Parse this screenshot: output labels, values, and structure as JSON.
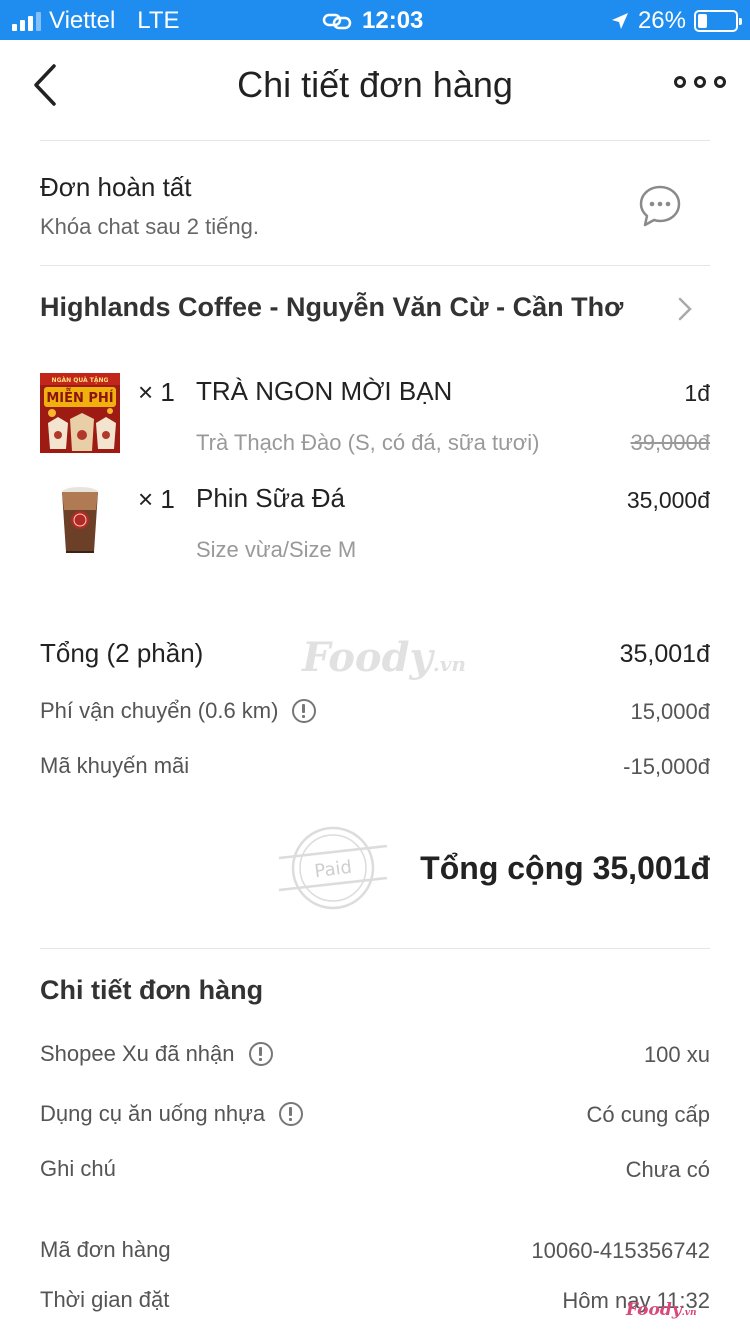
{
  "status_bar": {
    "carrier": "Viettel",
    "network": "LTE",
    "time": "12:03",
    "battery": "26%",
    "battery_level": 0.26
  },
  "header": {
    "title": "Chi tiết đơn hàng",
    "back_icon": "chevron-left-icon",
    "more_icon": "more-dots-icon"
  },
  "order_status": {
    "title": "Đơn hoàn tất",
    "subtitle": "Khóa chat sau 2 tiếng.",
    "chat_icon": "chat-bubble-icon"
  },
  "store": {
    "name": "Highlands Coffee - Nguyễn Văn Cừ - Cần Thơ"
  },
  "items": [
    {
      "qty": "× 1",
      "name": "TRÀ NGON MỜI BẠN",
      "price": "1đ",
      "note": "Trà Thạch Đào (S, có đá, sữa tươi)",
      "old_price": "39,000đ",
      "thumb_banner": "MIỄN PHÍ",
      "thumb_top": "NGÀN QUÀ TẶNG"
    },
    {
      "qty": "× 1",
      "name": "Phin Sữa Đá",
      "price": "35,000đ",
      "note": "Size vừa/Size M"
    }
  ],
  "summary": {
    "subtotal_label": "Tổng (2 phần)",
    "subtotal_value": "35,001đ",
    "shipping_label": "Phí vận chuyển (0.6 km)",
    "shipping_value": "15,000đ",
    "promo_label": "Mã khuyến mãi",
    "promo_value": "-15,000đ",
    "paid_stamp": "Paid",
    "grand_total": "Tổng cộng 35,001đ"
  },
  "watermark": {
    "brand": "Foody",
    "suffix": ".vn"
  },
  "details": {
    "section_title": "Chi tiết đơn hàng",
    "rows": [
      {
        "label": "Shopee Xu đã nhận",
        "value": "100 xu",
        "info": true
      },
      {
        "label": "Dụng cụ ăn uống nhựa",
        "value": "Có cung cấp",
        "info": true
      },
      {
        "label": "Ghi chú",
        "value": "Chưa có",
        "info": false
      },
      {
        "label": "Mã đơn hàng",
        "value": "10060-415356742",
        "info": false
      },
      {
        "label": "Thời gian đặt",
        "value": "Hôm nay 11:32",
        "info": false
      }
    ]
  },
  "colors": {
    "status_bar": "#1f8df0",
    "text_primary": "#222222",
    "text_secondary": "#999999",
    "divider": "#e6e6e6"
  }
}
